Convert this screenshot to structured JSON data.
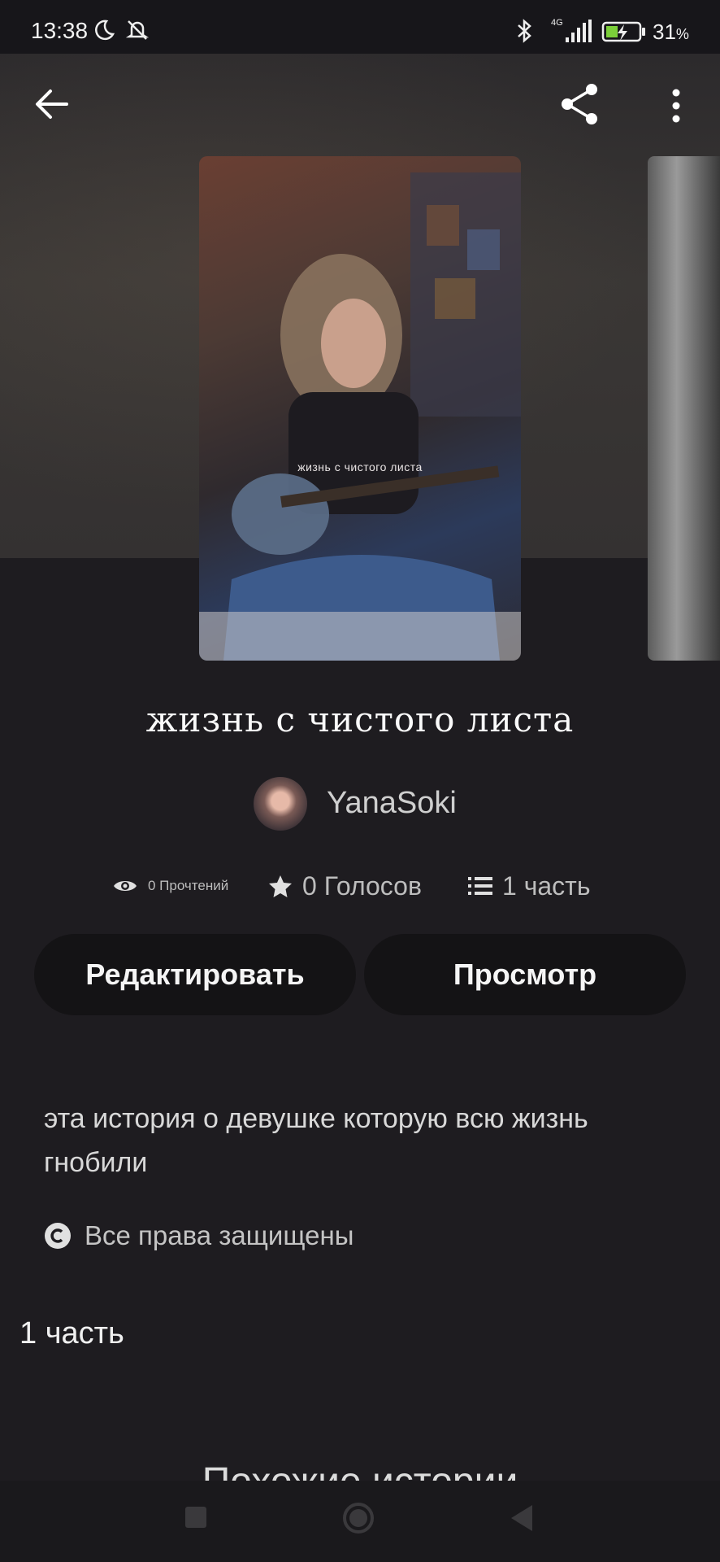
{
  "status_bar": {
    "time": "13:38",
    "battery_percent": "31",
    "battery_unit": "%",
    "network": "4G"
  },
  "story": {
    "cover_text": "жизнь с чистого листа",
    "title": "жизнь с чистого листа",
    "author": "YanaSoki",
    "stats": {
      "reads": "0 Прочтений",
      "votes": "0 Голосов",
      "parts": "1 часть"
    },
    "description": "эта история о девушке которую всю жизнь гнобили",
    "copyright": "Все права защищены"
  },
  "buttons": {
    "edit": "Редактировать",
    "view": "Просмотр"
  },
  "parts_heading": "1 часть",
  "similar_heading": "Похожие истории",
  "colors": {
    "background": "#1e1c20",
    "button_bg": "#141315",
    "text": "#ffffff"
  },
  "icons": [
    "back-arrow-icon",
    "share-icon",
    "more-vert-icon",
    "eye-icon",
    "star-icon",
    "list-icon",
    "copyright-icon",
    "moon-icon",
    "bell-off-icon",
    "bluetooth-icon",
    "signal-icon",
    "battery-charging-icon"
  ]
}
